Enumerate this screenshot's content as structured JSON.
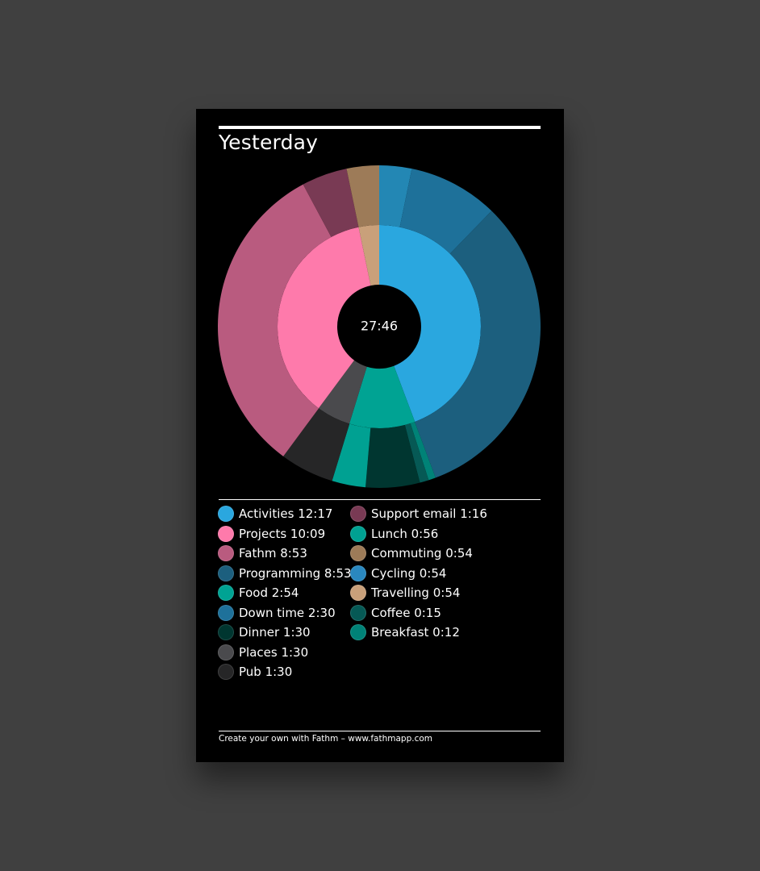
{
  "card": {
    "title": "Yesterday",
    "footer": "Create your own with Fathm – www.fathmapp.com"
  },
  "chart_data": {
    "type": "pie",
    "variant": "sunburst",
    "center_label": "27:46",
    "inner_ring": [
      {
        "name": "Activities",
        "duration": "12:17",
        "value": 12.2833,
        "color": "#2aa7df"
      },
      {
        "name": "Food",
        "duration": "2:54",
        "value": 2.9,
        "color": "#00a393"
      },
      {
        "name": "Places",
        "duration": "1:30",
        "value": 1.5,
        "color": "#4a4a4d"
      },
      {
        "name": "Projects",
        "duration": "10:09",
        "value": 10.15,
        "color": "#fe7aab"
      },
      {
        "name": "Travelling",
        "duration": "0:54",
        "value": 0.9,
        "color": "#c9a07a"
      }
    ],
    "outer_ring": [
      {
        "name": "Cycling",
        "duration": "0:54",
        "value": 0.9,
        "color": "#2387b4"
      },
      {
        "name": "Down time",
        "duration": "2:30",
        "value": 2.5,
        "color": "#1e719a"
      },
      {
        "name": "Programming",
        "duration": "8:53",
        "value": 8.8833,
        "color": "#1c5f7e"
      },
      {
        "name": "Breakfast",
        "duration": "0:12",
        "value": 0.2,
        "color": "#008277"
      },
      {
        "name": "Coffee",
        "duration": "0:15",
        "value": 0.25,
        "color": "#065955"
      },
      {
        "name": "Dinner",
        "duration": "1:30",
        "value": 1.5,
        "color": "#003630"
      },
      {
        "name": "Lunch",
        "duration": "0:56",
        "value": 0.9333,
        "color": "#00a192"
      },
      {
        "name": "Pub",
        "duration": "1:30",
        "value": 1.5,
        "color": "#262627"
      },
      {
        "name": "Fathm",
        "duration": "8:53",
        "value": 8.8833,
        "color": "#b95b7f"
      },
      {
        "name": "Support email",
        "duration": "1:16",
        "value": 1.2667,
        "color": "#793a54"
      },
      {
        "name": "Commuting",
        "duration": "0:54",
        "value": 0.9,
        "color": "#9d7b58"
      }
    ],
    "legend": [
      {
        "label": "Activities 12:17",
        "color": "#2aa7df"
      },
      {
        "label": "Projects 10:09",
        "color": "#fe7aab"
      },
      {
        "label": "Fathm 8:53",
        "color": "#b95b7f"
      },
      {
        "label": "Programming 8:53",
        "color": "#1c5f7e"
      },
      {
        "label": "Food 2:54",
        "color": "#00a393"
      },
      {
        "label": "Down time 2:30",
        "color": "#1e719a"
      },
      {
        "label": "Dinner 1:30",
        "color": "#003630"
      },
      {
        "label": "Places 1:30",
        "color": "#4a4a4d"
      },
      {
        "label": "Pub 1:30",
        "color": "#262627"
      },
      {
        "label": "Support email 1:16",
        "color": "#793a54"
      },
      {
        "label": "Lunch 0:56",
        "color": "#00a192"
      },
      {
        "label": "Commuting 0:54",
        "color": "#9d7b58"
      },
      {
        "label": "Cycling 0:54",
        "color": "#2a88bf"
      },
      {
        "label": "Travelling 0:54",
        "color": "#c9a07a"
      },
      {
        "label": "Coffee 0:15",
        "color": "#065955"
      },
      {
        "label": "Breakfast 0:12",
        "color": "#008277"
      }
    ]
  }
}
